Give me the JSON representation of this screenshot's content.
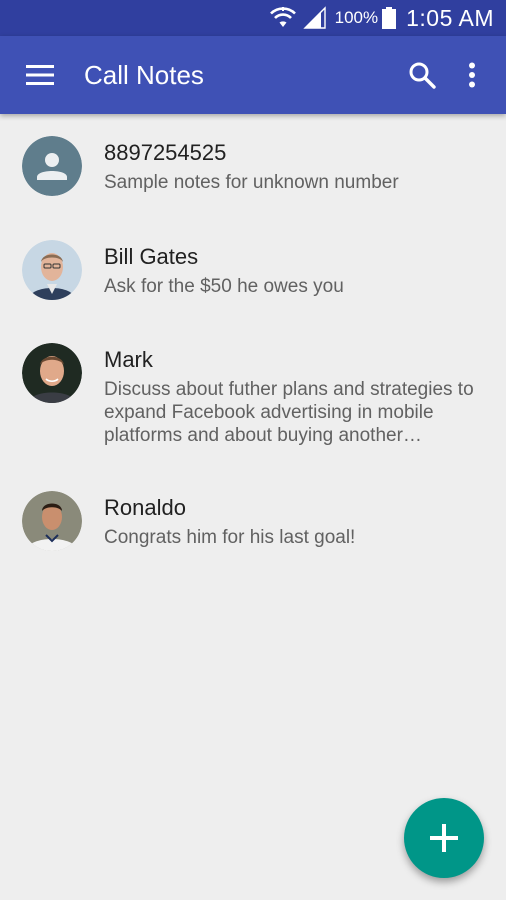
{
  "status_bar": {
    "battery_percent": "100%",
    "time": "1:05 AM",
    "icons": [
      "wifi-icon",
      "signal-icon",
      "battery-icon"
    ]
  },
  "app_bar": {
    "title": "Call Notes",
    "icons": [
      "menu-icon",
      "search-icon",
      "more-vert-icon"
    ],
    "color": "#3f51b5"
  },
  "notes": [
    {
      "name": "8897254525",
      "note": "Sample notes for unknown number",
      "avatar": "default-person-icon"
    },
    {
      "name": "Bill Gates",
      "note": "Ask for the $50 he owes you",
      "avatar": "contact-photo"
    },
    {
      "name": "Mark",
      "note": "Discuss about futher plans and strategies to expand Facebook advertising in mobile platforms and about buying another…",
      "avatar": "contact-photo"
    },
    {
      "name": "Ronaldo",
      "note": "Congrats him for his last goal!",
      "avatar": "contact-photo"
    }
  ],
  "fab": {
    "icon": "add-icon",
    "color": "#009688"
  }
}
